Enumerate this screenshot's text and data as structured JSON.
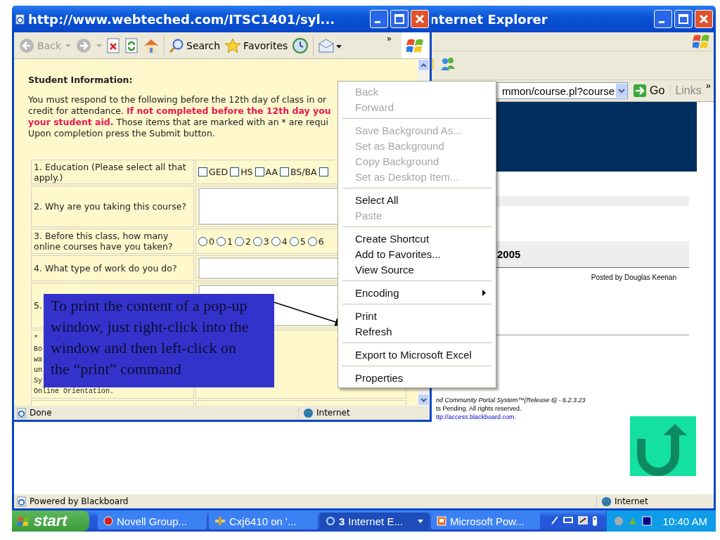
{
  "background_window": {
    "title": "nternet Explorer",
    "address": "mmon/course.pl?course",
    "go_button": "Go",
    "links": "Links",
    "toolbar_more": "»",
    "heading": "2005",
    "posted_by": "Posted by Douglas Keenan",
    "footer": [
      "nd Community Portal System™(Release 6) - 6.2.3.23",
      "ts Pending. All rights reserved."
    ],
    "footer_link": "ttp://access.blackboard.com",
    "footer_link_suffix": ".",
    "status_bar": {
      "text": "Powered by Blackboard",
      "zone": "Internet"
    }
  },
  "popup_window": {
    "title": "http://www.webteched.com/ITSC1401/syl...",
    "toolbar": {
      "back": "Back",
      "search": "Search",
      "favorites": "Favorites",
      "more": "»"
    },
    "section_title": "Student Information:",
    "intro": "You must respond to the following before the 12th day of class in or\ncredit for attendance. **If not completed before the 12th day you**\n**your student aid.** Those items that are marked with an * are requi\nUpon completion press the Submit button.",
    "questions": [
      {
        "kind": "checkboxes",
        "label": "1. Education (Please select all that apply.)",
        "options": [
          {
            "label": "GED",
            "checked": false
          },
          {
            "label": "HS",
            "checked": false
          },
          {
            "label": "AA",
            "checked": false
          },
          {
            "label": "BS/BA",
            "checked": false
          },
          {
            "checked": false
          }
        ]
      },
      {
        "kind": "textarea",
        "label": "2. Why are you taking this course?"
      },
      {
        "kind": "radios",
        "label": "3. Before this class, how many online courses have you taken?",
        "options": [
          {
            "label": "0",
            "selected": false
          },
          {
            "label": "1",
            "selected": false
          },
          {
            "label": "2",
            "selected": false
          },
          {
            "label": "3",
            "selected": false
          },
          {
            "label": "4",
            "selected": false
          },
          {
            "label": "5",
            "selected": false
          },
          {
            "label": "6",
            "selected": false
          }
        ]
      },
      {
        "kind": "input",
        "label": "4. What type of work do you do?"
      },
      {
        "kind": "textarea",
        "label": "5."
      },
      {
        "kind": "note",
        "lines": [
          "*",
          "Bo",
          "wa",
          "un",
          "Sy",
          "Online Orientation."
        ]
      }
    ],
    "status_bar": {
      "text": "Done",
      "zone": "Internet"
    }
  },
  "context_menu": {
    "groups": [
      [
        {
          "label": "Back",
          "disabled": true,
          "submenu": false
        },
        {
          "label": "Forward",
          "disabled": true,
          "submenu": false
        }
      ],
      [
        {
          "label": "Save Background As...",
          "disabled": true,
          "submenu": false
        },
        {
          "label": "Set as Background",
          "disabled": true,
          "submenu": false
        },
        {
          "label": "Copy Background",
          "disabled": true,
          "submenu": false
        },
        {
          "label": "Set as Desktop Item...",
          "disabled": true,
          "submenu": false
        }
      ],
      [
        {
          "label": "Select All",
          "disabled": false,
          "submenu": false
        },
        {
          "label": "Paste",
          "disabled": true,
          "submenu": false
        }
      ],
      [
        {
          "label": "Create Shortcut",
          "disabled": false,
          "submenu": false
        },
        {
          "label": "Add to Favorites...",
          "disabled": false,
          "submenu": false
        },
        {
          "label": "View Source",
          "disabled": false,
          "submenu": false
        }
      ],
      [
        {
          "label": "Encoding",
          "disabled": false,
          "submenu": true
        }
      ],
      [
        {
          "label": "Print",
          "disabled": false,
          "submenu": false
        },
        {
          "label": "Refresh",
          "disabled": false,
          "submenu": false
        }
      ],
      [
        {
          "label": "Export to Microsoft Excel",
          "disabled": false,
          "submenu": false
        }
      ],
      [
        {
          "label": "Properties",
          "disabled": false,
          "submenu": false
        }
      ]
    ]
  },
  "callout": {
    "text": "To print the content of a pop-up window, just right-click into the window and then left-click on the “print” command"
  },
  "taskbar": {
    "start": "start",
    "buttons": [
      {
        "label": "Novell Group...",
        "selected": false
      },
      {
        "label": "Cxj6410 on '...",
        "selected": false
      },
      {
        "count": "3",
        "label": "Internet E...",
        "selected": true
      },
      {
        "label": "Microsoft Pow...",
        "selected": false
      }
    ],
    "clock": "10:40 AM"
  }
}
